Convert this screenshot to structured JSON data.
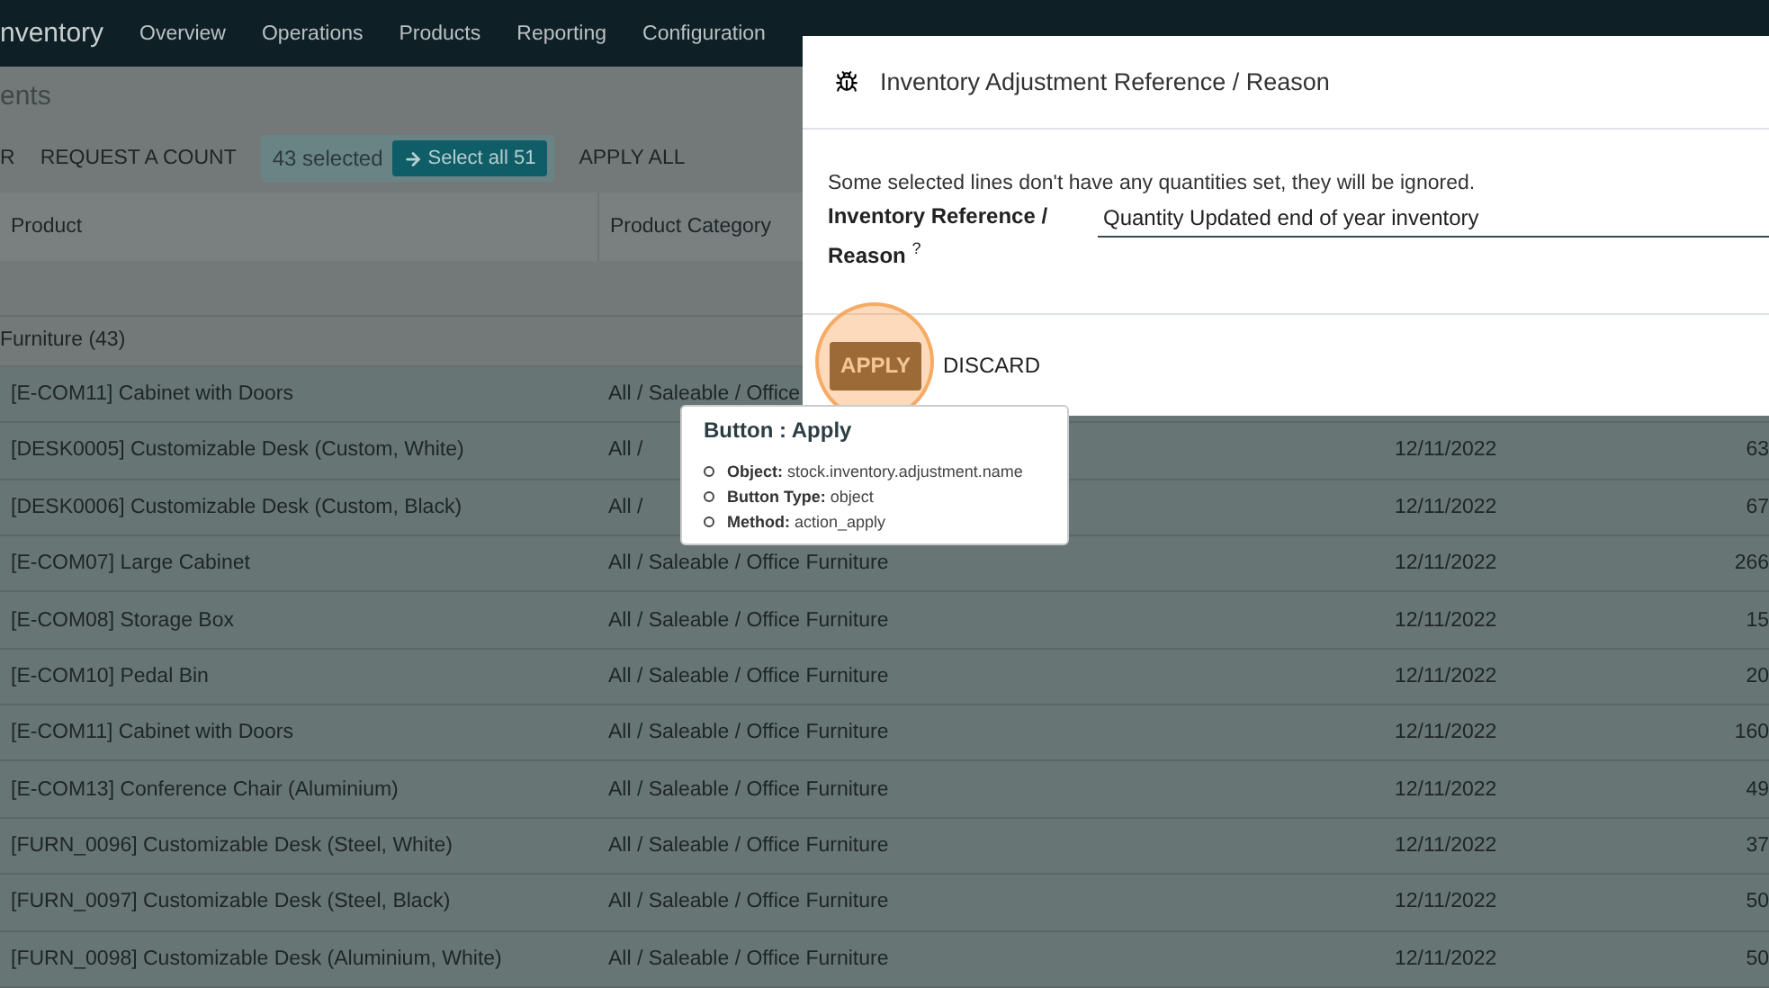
{
  "app": {
    "title": "nventory",
    "menu": [
      "Overview",
      "Operations",
      "Products",
      "Reporting",
      "Configuration"
    ]
  },
  "page": {
    "title": "ents"
  },
  "toolbar": {
    "buttons": [
      "R",
      "REQUEST A COUNT"
    ],
    "selection": {
      "count": "43 selected",
      "select_all": "Select all 51"
    },
    "apply_all": "APPLY ALL"
  },
  "table": {
    "columns": [
      "Product",
      "Product Category"
    ],
    "group": "Furniture (43)",
    "rows": [
      {
        "product": "[E-COM11] Cabinet with Doors",
        "category": "All / Saleable / Office",
        "selected": true
      },
      {
        "product": "[DESK0005] Customizable Desk (Custom, White)",
        "category": "All /",
        "date": "12/11/2022",
        "quantity": "63",
        "selected": true
      },
      {
        "product": "[DESK0006] Customizable Desk (Custom, Black)",
        "category": "All /",
        "date": "12/11/2022",
        "quantity": "67",
        "selected": true
      },
      {
        "product": "[E-COM07] Large Cabinet",
        "category": "All / Saleable / Office Furniture",
        "date": "12/11/2022",
        "quantity": "266",
        "selected": true
      },
      {
        "product": "[E-COM08] Storage Box",
        "category": "All / Saleable / Office Furniture",
        "date": "12/11/2022",
        "quantity": "15",
        "selected": true
      },
      {
        "product": "[E-COM10] Pedal Bin",
        "category": "All / Saleable / Office Furniture",
        "date": "12/11/2022",
        "quantity": "20",
        "selected": true
      },
      {
        "product": "[E-COM11] Cabinet with Doors",
        "category": "All / Saleable / Office Furniture",
        "date": "12/11/2022",
        "quantity": "160",
        "selected": true
      },
      {
        "product": "[E-COM13] Conference Chair (Aluminium)",
        "category": "All / Saleable / Office Furniture",
        "date": "12/11/2022",
        "quantity": "49",
        "selected": true
      },
      {
        "product": "[FURN_0096] Customizable Desk (Steel, White)",
        "category": "All / Saleable / Office Furniture",
        "date": "12/11/2022",
        "quantity": "37",
        "selected": true
      },
      {
        "product": "[FURN_0097] Customizable Desk (Steel, Black)",
        "category": "All / Saleable / Office Furniture",
        "date": "12/11/2022",
        "quantity": "50",
        "selected": true
      },
      {
        "product": "[FURN_0098] Customizable Desk (Aluminium, White)",
        "category": "All / Saleable / Office Furniture",
        "date": "12/11/2022",
        "quantity": "50",
        "selected": true
      }
    ]
  },
  "dialog": {
    "title": "Inventory Adjustment Reference / Reason",
    "message": "Some selected lines don't have any quantities set, they will be ignored.",
    "field": {
      "label": "Inventory Reference / Reason $^{?}$",
      "value": "Quantity Updated end of year inventory"
    },
    "buttons": [
      {
        "label": "APPLY",
        "kind": "primary"
      },
      {
        "label": "DISCARD",
        "kind": "secondary"
      }
    ]
  },
  "tooltip": {
    "title": "Button : Apply",
    "items": [
      {
        "label": "Object:",
        "value": "stock.inventory.adjustment.name"
      },
      {
        "label": "Button Type:",
        "value": "object"
      },
      {
        "label": "Method:",
        "value": "action_apply"
      }
    ]
  }
}
